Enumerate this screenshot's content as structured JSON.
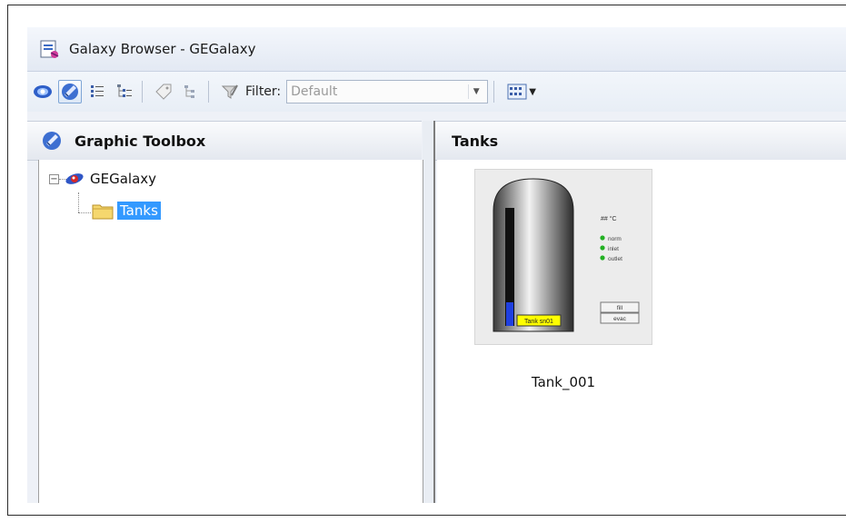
{
  "window": {
    "title": "Galaxy Browser - GEGalaxy"
  },
  "toolbar": {
    "filter_label": "Filter:",
    "filter_value": "Default",
    "buttons": [
      "galaxy-icon",
      "graphic-toolbox-icon",
      "list-view-icon",
      "tree-view-icon",
      "tag-icon",
      "hierarchy-icon",
      "filter-edit-icon",
      "view-options-icon"
    ]
  },
  "left_panel": {
    "title": "Graphic Toolbox",
    "tree": {
      "root": {
        "label": "GEGalaxy",
        "expander": "−"
      },
      "children": [
        {
          "label": "Tanks",
          "selected": true
        }
      ]
    }
  },
  "right_panel": {
    "title": "Tanks",
    "items": [
      {
        "name": "Tank_001",
        "preview": {
          "temp_label": "## °C",
          "status": [
            "norm",
            "inlet",
            "outlet"
          ],
          "buttons": [
            "fill",
            "evac"
          ],
          "tank_tag": "Tank sn01",
          "level_fraction": 0.2
        }
      }
    ]
  },
  "colors": {
    "selection": "#3399ff",
    "status_green": "#22b022",
    "level_fill": "#1f3fe0",
    "tag_yellow": "#ffff00"
  }
}
